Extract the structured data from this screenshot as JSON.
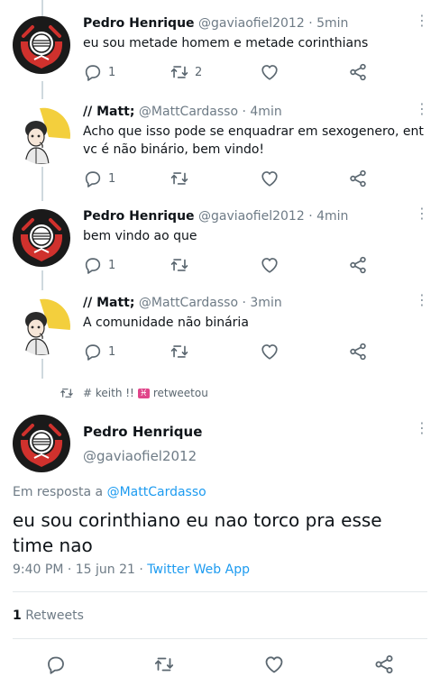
{
  "thread": [
    {
      "author": "Pedro Henrique",
      "handle": "@gaviaofiel2012",
      "time": "· 5min",
      "text": "eu sou metade homem e metade corinthians",
      "replies": "1",
      "retweets": "2",
      "likes": ""
    },
    {
      "author": "// Matt;",
      "handle": "@MattCardasso",
      "time": "· 4min",
      "text": "Acho que isso pode se enquadrar em sexogenero, ent vc é não binário, bem vindo!",
      "replies": "1",
      "retweets": "",
      "likes": ""
    },
    {
      "author": "Pedro Henrique",
      "handle": "@gaviaofiel2012",
      "time": "· 4min",
      "text": "bem vindo ao que",
      "replies": "1",
      "retweets": "",
      "likes": ""
    },
    {
      "author": "// Matt;",
      "handle": "@MattCardasso",
      "time": "· 3min",
      "text": "A comunidade não binária",
      "replies": "1",
      "retweets": "",
      "likes": ""
    }
  ],
  "retweet_notice": {
    "user": "# keith !!",
    "emoji": "♓",
    "action": "retweetou"
  },
  "main_tweet": {
    "author": "Pedro Henrique",
    "handle": "@gaviaofiel2012",
    "reply_prefix": "Em resposta a",
    "reply_to": "@MattCardasso",
    "text": "eu sou corinthiano eu nao torco pra esse time nao",
    "time": "9:40 PM · 15 jun 21 ·",
    "source": "Twitter Web App",
    "retweet_count": "1",
    "retweet_label": "Retweets"
  },
  "icons": {
    "reply": "reply-icon",
    "retweet": "retweet-icon",
    "like": "like-icon",
    "share": "share-icon",
    "menu": "more-icon"
  },
  "colors": {
    "accent": "#1d9bf0",
    "muted": "#6e7b86",
    "icon": "#5b6770",
    "corinthians_black": "#1a1a1a",
    "corinthians_red": "#d0312d",
    "matt_bg": "#f3cf3d"
  }
}
